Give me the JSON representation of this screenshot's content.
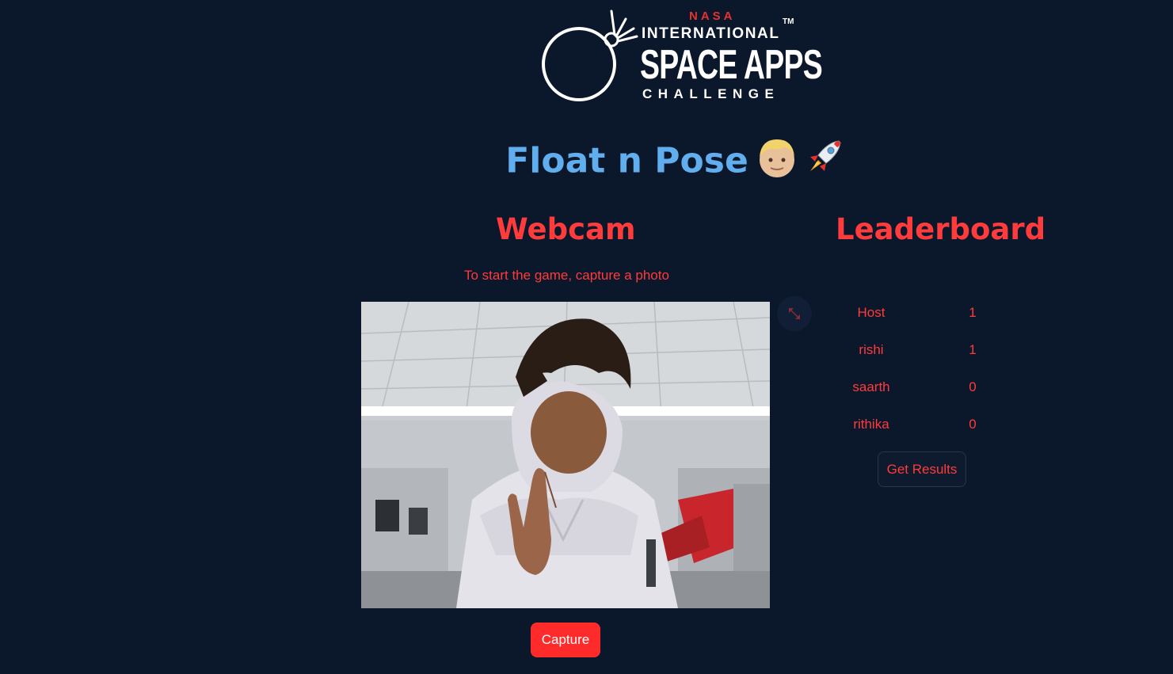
{
  "logo": {
    "nasa": "NASA",
    "international": "INTERNATIONAL",
    "space_apps": "SPACE APPS",
    "challenge": "CHALLENGE",
    "tm": "TM"
  },
  "title": {
    "text": "Float n Pose",
    "emoji": "👱🏼 🚀"
  },
  "webcam": {
    "heading": "Webcam",
    "instruction": "To start the game, capture a photo",
    "capture_label": "Capture",
    "fullscreen_icon": "expand-arrows-icon"
  },
  "leaderboard": {
    "heading": "Leaderboard",
    "rows": [
      {
        "name": "Host",
        "score": "1"
      },
      {
        "name": "rishi",
        "score": "1"
      },
      {
        "name": "saarth",
        "score": "0"
      },
      {
        "name": "rithika",
        "score": "0"
      }
    ],
    "results_label": "Get Results"
  },
  "colors": {
    "background": "#0b172b",
    "accent_red": "#ff2b2b",
    "title_blue": "#61aeee",
    "nasa_red": "#e5322d"
  }
}
